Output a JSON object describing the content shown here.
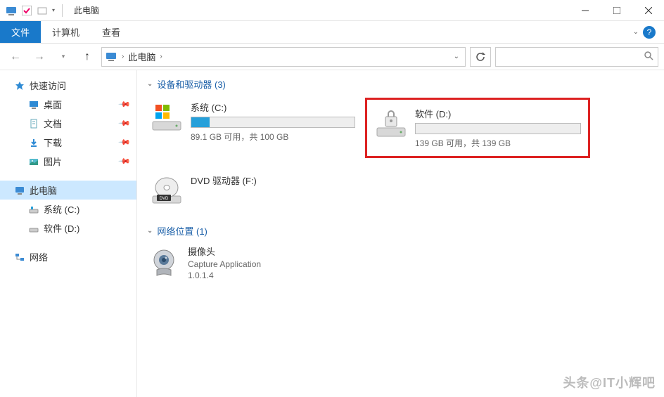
{
  "titlebar": {
    "title": "此电脑"
  },
  "ribbon": {
    "file": "文件",
    "tabs": [
      "计算机",
      "查看"
    ]
  },
  "nav": {
    "breadcrumb_root": "此电脑",
    "search_placeholder": ""
  },
  "sidebar": {
    "quick_access": "快速访问",
    "quick_items": [
      {
        "label": "桌面",
        "icon": "desktop"
      },
      {
        "label": "文档",
        "icon": "document"
      },
      {
        "label": "下载",
        "icon": "download"
      },
      {
        "label": "图片",
        "icon": "pictures"
      }
    ],
    "this_pc": "此电脑",
    "this_pc_items": [
      {
        "label": "系统 (C:)"
      },
      {
        "label": "软件 (D:)"
      }
    ],
    "network": "网络"
  },
  "content": {
    "devices_header": "设备和驱动器 (3)",
    "drives": [
      {
        "name": "系统 (C:)",
        "stat": "89.1 GB 可用，共 100 GB",
        "fill_pct": 11,
        "type": "os",
        "highlight": false
      },
      {
        "name": "软件 (D:)",
        "stat": "139 GB 可用，共 139 GB",
        "fill_pct": 0,
        "type": "locked",
        "highlight": true
      },
      {
        "name": "DVD 驱动器 (F:)",
        "stat": "",
        "fill_pct": null,
        "type": "dvd",
        "highlight": false
      }
    ],
    "network_header": "网络位置 (1)",
    "network_items": [
      {
        "name": "摄像头",
        "sub1": "Capture Application",
        "sub2": "1.0.1.4"
      }
    ]
  },
  "watermark": "头条@IT小辉吧"
}
